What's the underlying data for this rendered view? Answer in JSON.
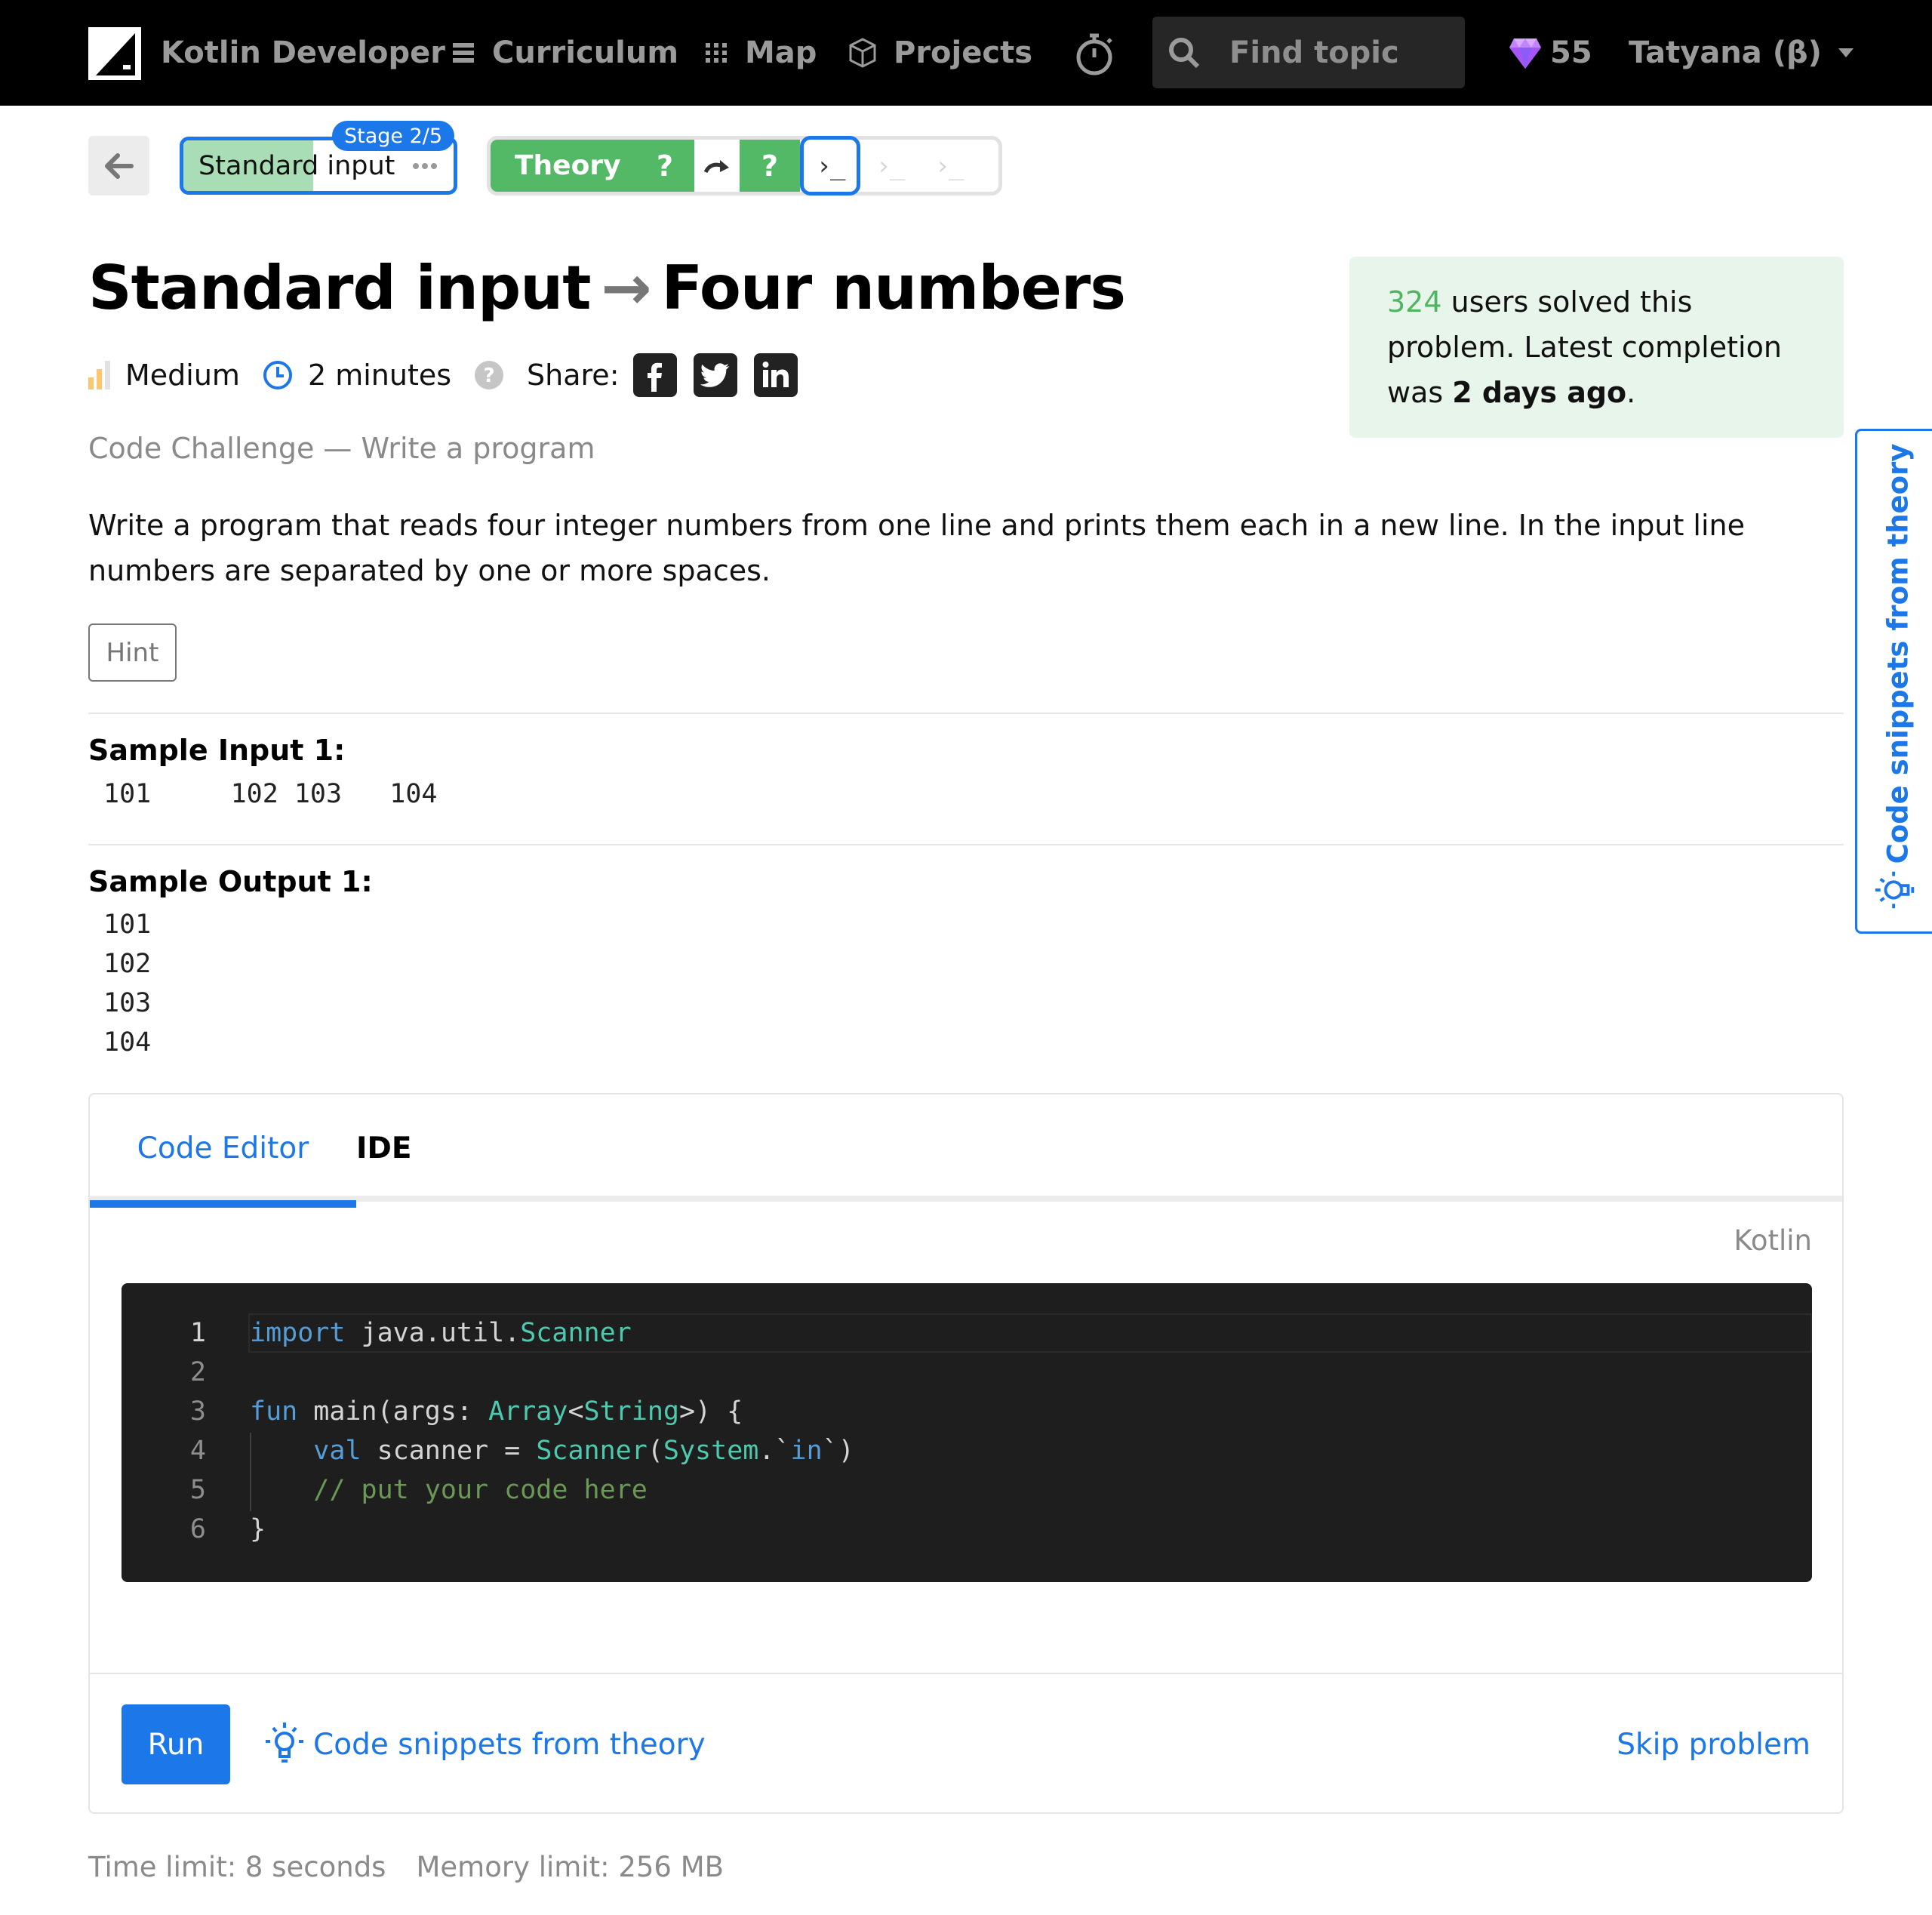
{
  "nav": {
    "brand": "Kotlin Developer",
    "items": [
      {
        "label": "Curriculum",
        "icon": "list-icon"
      },
      {
        "label": "Map",
        "icon": "grid-icon"
      },
      {
        "label": "Projects",
        "icon": "cube-icon"
      }
    ],
    "timer_icon": "stopwatch-icon",
    "search": {
      "placeholder": "Find topic",
      "value": ""
    },
    "gems": "55",
    "user": "Tatyana (β)"
  },
  "breadcrumb": {
    "back_icon": "arrow-left-icon",
    "stage_label": "Standard input",
    "stage_badge": "Stage 2/5",
    "stage_progress": 0.48,
    "steps": [
      {
        "type": "theory",
        "label": "Theory",
        "mark": "?",
        "state": "done"
      },
      {
        "type": "skip",
        "icon": "skip-arrow-icon",
        "state": "skipped"
      },
      {
        "type": "quiz",
        "mark": "?",
        "state": "done"
      },
      {
        "type": "code",
        "icon": "terminal-icon",
        "state": "current"
      },
      {
        "type": "code",
        "icon": "terminal-icon",
        "state": "locked"
      },
      {
        "type": "code",
        "icon": "terminal-icon",
        "state": "locked"
      }
    ],
    "terminal_glyph": "›_"
  },
  "problem": {
    "title_topic": "Standard input",
    "title_arrow": "→",
    "title_name": "Four numbers",
    "difficulty": "Medium",
    "duration": "2 minutes",
    "share_label": "Share:",
    "subtitle": "Code Challenge — Write a program",
    "description": "Write a program that reads four integer numbers from one line and prints them each in a new line. In the input line numbers are separated by one or more spaces.",
    "hint_label": "Hint"
  },
  "stats": {
    "solved_count": "324",
    "text_1": " users solved this problem. Latest completion was ",
    "latest": "2 days ago",
    "text_2": "."
  },
  "samples": {
    "input_heading": "Sample Input 1:",
    "input_value": "101     102 103   104",
    "output_heading": "Sample Output 1:",
    "output_lines": [
      "101",
      "102",
      "103",
      "104"
    ]
  },
  "editor": {
    "tabs": [
      {
        "label": "Code Editor",
        "active": true
      },
      {
        "label": "IDE",
        "active": false
      }
    ],
    "language": "Kotlin",
    "lines": [
      {
        "n": "1",
        "tokens": [
          {
            "t": "import",
            "c": "kw"
          },
          {
            "t": " java.util.",
            "c": ""
          },
          {
            "t": "Scanner",
            "c": "ty"
          }
        ]
      },
      {
        "n": "2",
        "tokens": []
      },
      {
        "n": "3",
        "tokens": [
          {
            "t": "fun",
            "c": "kw"
          },
          {
            "t": " main(args: ",
            "c": ""
          },
          {
            "t": "Array",
            "c": "ty"
          },
          {
            "t": "<",
            "c": ""
          },
          {
            "t": "String",
            "c": "ty"
          },
          {
            "t": ">) {",
            "c": ""
          }
        ]
      },
      {
        "n": "4",
        "tokens": [
          {
            "t": "    ",
            "c": ""
          },
          {
            "t": "val",
            "c": "kw"
          },
          {
            "t": " scanner = ",
            "c": ""
          },
          {
            "t": "Scanner",
            "c": "ty"
          },
          {
            "t": "(",
            "c": ""
          },
          {
            "t": "System",
            "c": "ty"
          },
          {
            "t": ".`",
            "c": ""
          },
          {
            "t": "in",
            "c": "kw"
          },
          {
            "t": "`)",
            "c": ""
          }
        ]
      },
      {
        "n": "5",
        "tokens": [
          {
            "t": "    ",
            "c": ""
          },
          {
            "t": "// put your code here",
            "c": "cm"
          }
        ]
      },
      {
        "n": "6",
        "tokens": [
          {
            "t": "}",
            "c": ""
          }
        ]
      }
    ],
    "run_label": "Run",
    "snippets_label": "Code snippets from theory",
    "skip_label": "Skip problem"
  },
  "limits": {
    "time": "Time limit: 8 seconds",
    "memory": "Memory limit: 256 MB"
  },
  "side_tab": {
    "label": "Code snippets from theory"
  },
  "colors": {
    "accent": "#1c78e8",
    "success": "#53b966",
    "stats_bg": "#e8f5ea",
    "gem": "#a855f7",
    "difficulty": "#fbc66e"
  }
}
